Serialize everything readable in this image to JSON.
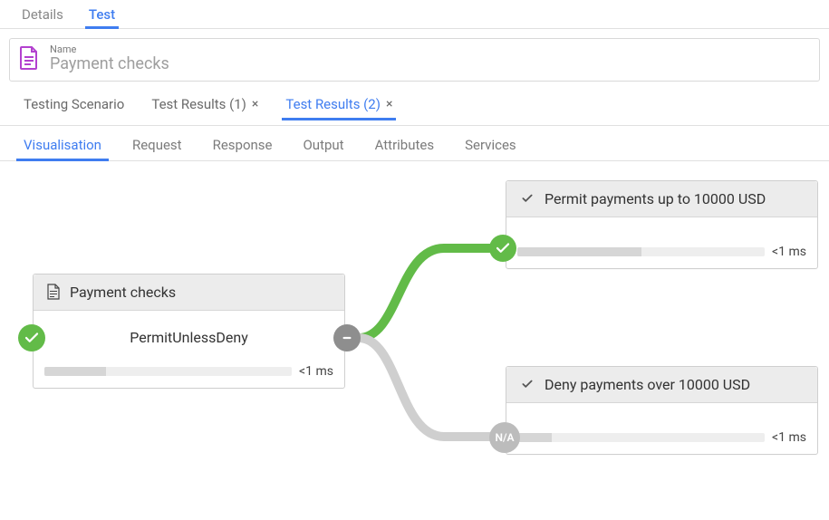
{
  "colors": {
    "accent": "#3f7df0",
    "green": "#62bb48",
    "grey": "#8e8e8e",
    "na": "#bcbcbc"
  },
  "top_tabs": {
    "details": "Details",
    "test": "Test",
    "active": "test"
  },
  "name_row": {
    "label": "Name",
    "value": "Payment checks"
  },
  "results_tabs": {
    "items": [
      "Testing Scenario",
      "Test Results (1)",
      "Test Results (2)"
    ],
    "closable": [
      false,
      true,
      true
    ],
    "active_index": 2
  },
  "subtabs": {
    "items": [
      "Visualisation",
      "Request",
      "Response",
      "Output",
      "Attributes",
      "Services"
    ],
    "active_index": 0
  },
  "nodes": {
    "root": {
      "title": "Payment checks",
      "combining": "PermitUnlessDeny",
      "timing": "<1 ms",
      "progress_pct": 25,
      "left_badge": "check-green",
      "right_badge": "minus-grey"
    },
    "top": {
      "title": "Permit payments up to 10000 USD",
      "timing": "<1 ms",
      "progress_pct": 50,
      "left_badge": "check-green"
    },
    "bottom": {
      "title": "Deny payments over 10000 USD",
      "timing": "<1 ms",
      "progress_pct": 14,
      "left_badge": "na",
      "na_text": "N/A"
    }
  }
}
